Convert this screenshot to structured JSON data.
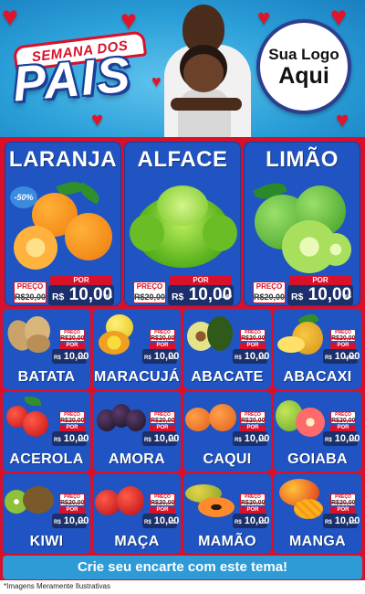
{
  "header": {
    "title_top": "SEMANA DOS",
    "title_main": "PAIS",
    "logo_line1": "Sua Logo",
    "logo_line2": "Aqui"
  },
  "featured": [
    {
      "name": "LARANJA",
      "badge": "-50%",
      "price_label": "PREÇO",
      "old_price": "R$20,00",
      "por_label": "POR",
      "currency": "R$",
      "price": "10,00",
      "unit": "KG"
    },
    {
      "name": "ALFACE",
      "price_label": "PREÇO",
      "old_price": "R$20,00",
      "por_label": "POR",
      "currency": "R$",
      "price": "10,00",
      "unit": "UNID"
    },
    {
      "name": "LIMÃO",
      "price_label": "PREÇO",
      "old_price": "R$20,00",
      "por_label": "POR",
      "currency": "R$",
      "price": "10,00",
      "unit": "KG"
    }
  ],
  "products": [
    {
      "name": "BATATA",
      "price_label": "PREÇO",
      "old_price": "R$20,00",
      "por_label": "POR",
      "currency": "R$",
      "price": "10,00",
      "unit": "KG"
    },
    {
      "name": "MARACUJÁ",
      "price_label": "PREÇO",
      "old_price": "R$20,00",
      "por_label": "POR",
      "currency": "R$",
      "price": "10,00",
      "unit": "KG"
    },
    {
      "name": "ABACATE",
      "price_label": "PREÇO",
      "old_price": "R$20,00",
      "por_label": "POR",
      "currency": "R$",
      "price": "10,00",
      "unit": "KG"
    },
    {
      "name": "ABACAXI",
      "price_label": "PREÇO",
      "old_price": "R$20,00",
      "por_label": "POR",
      "currency": "R$",
      "price": "10,00",
      "unit": "UNID"
    },
    {
      "name": "ACEROLA",
      "price_label": "PREÇO",
      "old_price": "R$20,00",
      "por_label": "POR",
      "currency": "R$",
      "price": "10,00",
      "unit": "KG"
    },
    {
      "name": "AMORA",
      "price_label": "PREÇO",
      "old_price": "R$20,00",
      "por_label": "POR",
      "currency": "R$",
      "price": "10,00",
      "unit": "KG"
    },
    {
      "name": "CAQUI",
      "price_label": "PREÇO",
      "old_price": "R$20,00",
      "por_label": "POR",
      "currency": "R$",
      "price": "10,00",
      "unit": "KG"
    },
    {
      "name": "GOIABA",
      "price_label": "PREÇO",
      "old_price": "R$20,00",
      "por_label": "POR",
      "currency": "R$",
      "price": "10,00",
      "unit": "KG"
    },
    {
      "name": "KIWI",
      "price_label": "PREÇO",
      "old_price": "R$20,00",
      "por_label": "POR",
      "currency": "R$",
      "price": "10,00",
      "unit": "KG"
    },
    {
      "name": "MAÇA",
      "price_label": "PREÇO",
      "old_price": "R$20,00",
      "por_label": "POR",
      "currency": "R$",
      "price": "10,00",
      "unit": "KG"
    },
    {
      "name": "MAMÃO",
      "price_label": "PREÇO",
      "old_price": "R$20,00",
      "por_label": "POR",
      "currency": "R$",
      "price": "10,00",
      "unit": "KG"
    },
    {
      "name": "MANGA",
      "price_label": "PREÇO",
      "old_price": "R$20,00",
      "por_label": "POR",
      "currency": "R$",
      "price": "10,00",
      "unit": "KG"
    }
  ],
  "footer": {
    "cta": "Crie seu encarte com este tema!",
    "disclaimer": "*Imagens Meramente Ilustrativas"
  },
  "colors": {
    "primary_blue": "#2054c2",
    "red": "#d8102a",
    "navy": "#1b2f6b",
    "sky": "#2e9bd6"
  }
}
